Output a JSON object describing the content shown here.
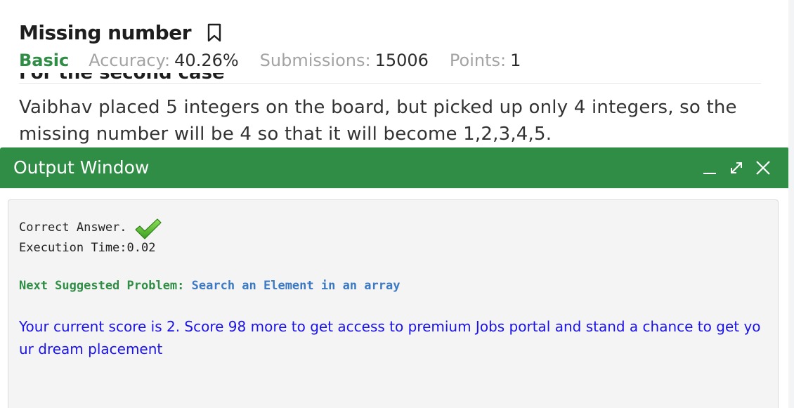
{
  "problem": {
    "title": "Missing number",
    "difficulty": "Basic",
    "accuracy_label": "Accuracy:",
    "accuracy_value": "40.26%",
    "submissions_label": "Submissions:",
    "submissions_value": "15006",
    "points_label": "Points:",
    "points_value": "1",
    "section_heading": "For the second case",
    "description": "Vaibhav placed 5 integers on the board, but picked up only 4 integers, so the missing number will be 4 so that it will become 1,2,3,4,5."
  },
  "output_window": {
    "title": "Output Window",
    "status": "Correct Answer.",
    "execution_time": "Execution Time:0.02",
    "next_label": "Next Suggested Problem:",
    "next_problem": "Search an Element in an array",
    "score_message": "Your current score is 2. Score 98 more to get access to premium Jobs portal and stand a chance to get your dream placement"
  },
  "icons": {
    "bookmark": "bookmark-icon",
    "minimize": "minimize-icon",
    "expand": "expand-icon",
    "close": "close-icon",
    "check": "checkmark-icon"
  },
  "colors": {
    "brand_green": "#2f8d46",
    "link_blue": "#3b79c5",
    "score_blue": "#1a12e8",
    "muted_gray": "#a3a3a3"
  }
}
